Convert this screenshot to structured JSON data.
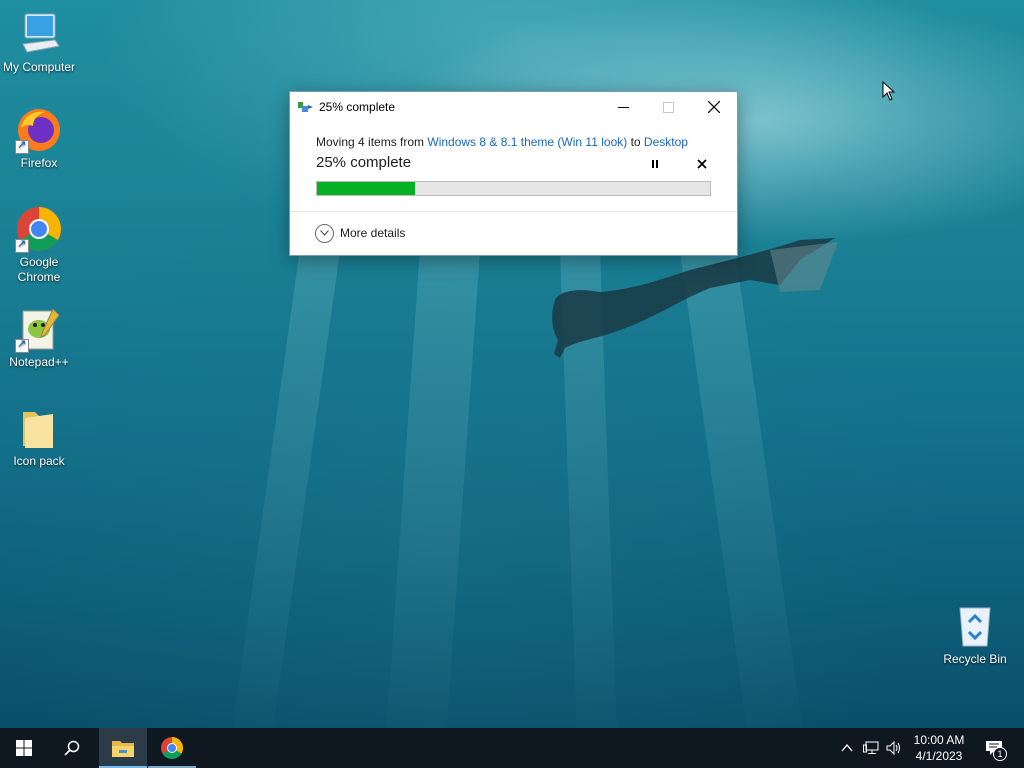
{
  "desktop": {
    "icons": [
      {
        "label": "My Computer",
        "icon": "computer-icon"
      },
      {
        "label": "Firefox",
        "icon": "firefox-icon"
      },
      {
        "label": "Google Chrome",
        "icon": "chrome-icon"
      },
      {
        "label": "Notepad++",
        "icon": "notepadpp-icon"
      },
      {
        "label": "Icon pack",
        "icon": "folder-icon"
      },
      {
        "label": "Recycle Bin",
        "icon": "recycle-bin-icon"
      }
    ]
  },
  "dialog": {
    "title": "25% complete",
    "message_prefix": "Moving 4 items from ",
    "source": "Windows 8 & 8.1 theme (Win 11 look)",
    "message_mid": " to ",
    "destination": "Desktop",
    "status": "25% complete",
    "progress_percent": 25,
    "details_label": "More details",
    "accent_color": "#06b025"
  },
  "taskbar": {
    "time": "10:00 AM",
    "date": "4/1/2023",
    "notification_count": "1",
    "pinned": [
      "start-icon",
      "search-icon",
      "file-explorer-icon",
      "chrome-icon"
    ]
  }
}
